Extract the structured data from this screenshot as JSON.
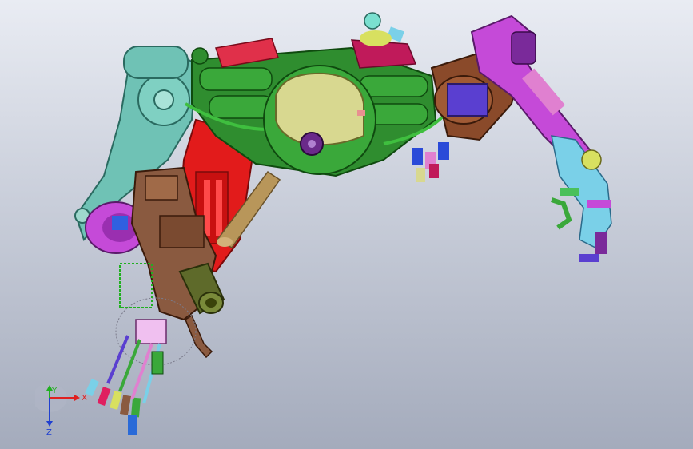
{
  "viewport": {
    "background_top": "#e9ecf3",
    "background_bottom": "#a4abbc"
  },
  "triad": {
    "x_label": "X",
    "y_label": "Y",
    "z_label": "Z",
    "x_color": "#e02020",
    "y_color": "#20b020",
    "z_color": "#2040d0"
  },
  "colors": {
    "shoulder_teal": "#6fc2b5",
    "body_green": "#2f8d2f",
    "head_yellow": "#d8d890",
    "arm_red": "#e21b1b",
    "bracket_brown": "#8a4a2a",
    "joint_magenta": "#c54ad8",
    "cylinder_blue": "#5a3fd0",
    "barrel_olive": "#5e6a2a",
    "rod_tan": "#b8965a"
  }
}
